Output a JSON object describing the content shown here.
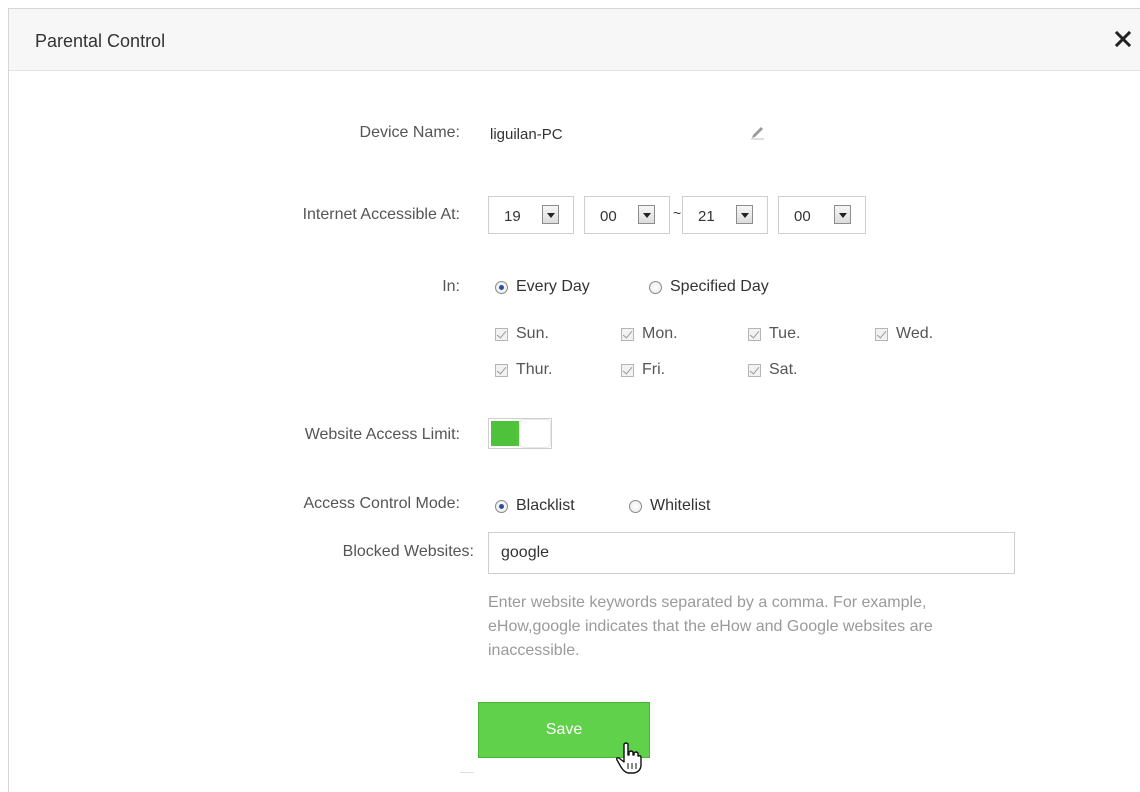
{
  "dialog": {
    "title": "Parental Control",
    "close_icon": "close-icon"
  },
  "device": {
    "label": "Device Name:",
    "value": "liguilan-PC",
    "edit_icon": "pencil-icon"
  },
  "time": {
    "label": "Internet Accessible At:",
    "start_hour": "19",
    "start_min": "00",
    "separator": "~",
    "end_hour": "21",
    "end_min": "00"
  },
  "days": {
    "label": "In:",
    "every_day": "Every Day",
    "specified_day": "Specified Day",
    "selected": "Every Day",
    "items": [
      "Sun.",
      "Mon.",
      "Tue.",
      "Wed.",
      "Thur.",
      "Fri.",
      "Sat."
    ]
  },
  "website_limit": {
    "label": "Website Access Limit:",
    "enabled": true,
    "on_color": "#4fc23b"
  },
  "mode": {
    "label": "Access Control Mode:",
    "blacklist": "Blacklist",
    "whitelist": "Whitelist",
    "selected": "Blacklist"
  },
  "blocked": {
    "label": "Blocked Websites:",
    "value": "google",
    "hint": "Enter website keywords separated by a comma. For example, eHow,google indicates that the eHow and Google websites are inaccessible."
  },
  "save": {
    "label": "Save",
    "color": "#5fd14a"
  }
}
